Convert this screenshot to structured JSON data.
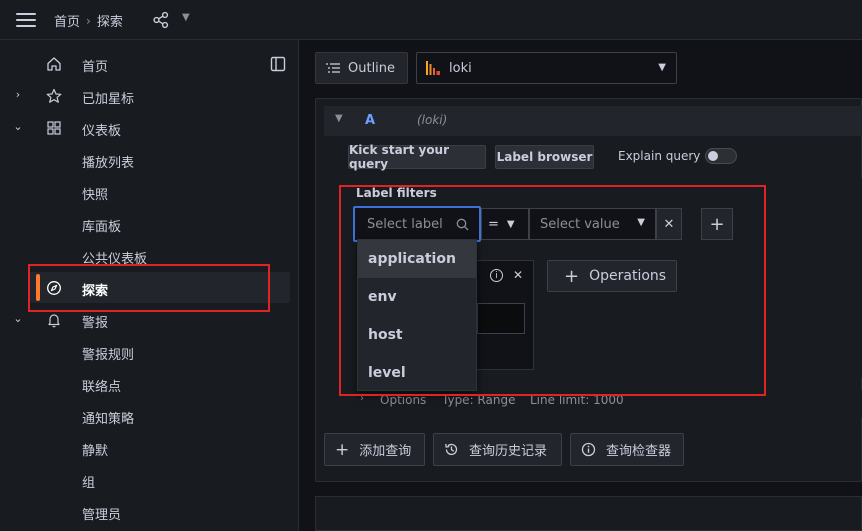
{
  "breadcrumb": {
    "home": "首页",
    "current": "探索"
  },
  "sidebar": {
    "items": [
      {
        "label": "首页",
        "icon": "home-icon",
        "chevron": ""
      },
      {
        "label": "已加星标",
        "icon": "star-icon",
        "chevron": "›"
      },
      {
        "label": "仪表板",
        "icon": "apps-icon",
        "chevron": "⌄"
      },
      {
        "label": "播放列表"
      },
      {
        "label": "快照"
      },
      {
        "label": "库面板"
      },
      {
        "label": "公共仪表板"
      },
      {
        "label": "探索",
        "icon": "compass-icon",
        "active": true
      },
      {
        "label": "警报",
        "icon": "bell-icon",
        "chevron": "⌄"
      },
      {
        "label": "警报规则"
      },
      {
        "label": "联络点"
      },
      {
        "label": "通知策略"
      },
      {
        "label": "静默"
      },
      {
        "label": "组"
      },
      {
        "label": "管理员"
      }
    ]
  },
  "toolbar": {
    "outline_label": "Outline",
    "datasource": "loki"
  },
  "query": {
    "ref_id": "A",
    "datasource_hint": "(loki)",
    "kick_start": "Kick start your query",
    "label_browser": "Label browser",
    "explain": "Explain query",
    "label_filters_title": "Label filters",
    "label_placeholder": "Select label",
    "operator": "=",
    "value_placeholder": "Select value",
    "operations_label": "Operations",
    "options": {
      "label": "Options",
      "type": "Type: Range",
      "limit": "Line limit: 1000"
    }
  },
  "dropdown": {
    "options": [
      "application",
      "env",
      "host",
      "level"
    ]
  },
  "footer": {
    "add_query": "添加查询",
    "history": "查询历史记录",
    "inspector": "查询检查器"
  },
  "colors": {
    "accent_orange": "#ff7a2f",
    "annotation_red": "#e02424",
    "focus_blue": "#3d71d9",
    "ref_blue": "#6e9fff"
  }
}
